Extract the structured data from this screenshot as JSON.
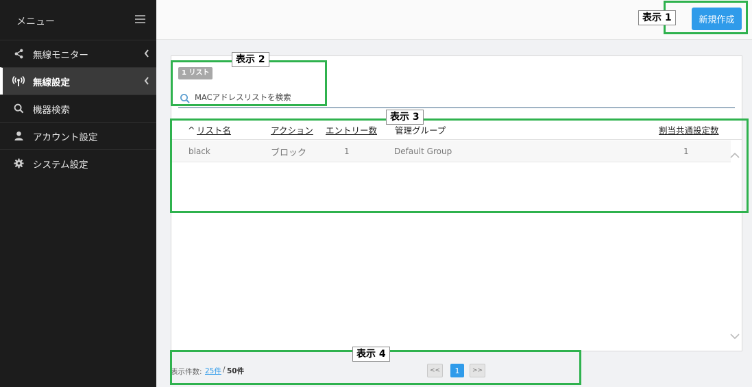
{
  "sidebar": {
    "title": "メニュー",
    "items": [
      {
        "label": "無線モニター",
        "icon": "share-icon"
      },
      {
        "label": "無線設定",
        "icon": "antenna-icon"
      },
      {
        "label": "機器検索",
        "icon": "search-icon"
      },
      {
        "label": "アカウント設定",
        "icon": "user-icon"
      },
      {
        "label": "システム設定",
        "icon": "gear-icon"
      }
    ],
    "active": "無線設定"
  },
  "toolbar": {
    "new_label": "新規作成"
  },
  "main": {
    "badge": "1 リスト",
    "search_placeholder": "MACアドレスリストを検索",
    "table": {
      "columns": [
        "^",
        "リスト名",
        "アクション",
        "エントリー数",
        "管理グループ",
        "割当共通設定数"
      ],
      "rows": [
        {
          "name": "black",
          "action": "ブロック",
          "entries": "1",
          "group": "Default Group",
          "assigned": "1"
        }
      ]
    }
  },
  "footer": {
    "label": "表示件数:",
    "per_page": "25件",
    "slash": "/",
    "total": "50件",
    "prev": "<<",
    "current_page": "1",
    "next": ">>"
  },
  "annotations": [
    "表示 1",
    "表示 2",
    "表示 3",
    "表示 4"
  ],
  "colors": {
    "accent": "#2f9bea",
    "annotation": "#2fb24e",
    "sidebar_bg": "#1c1c1c"
  }
}
